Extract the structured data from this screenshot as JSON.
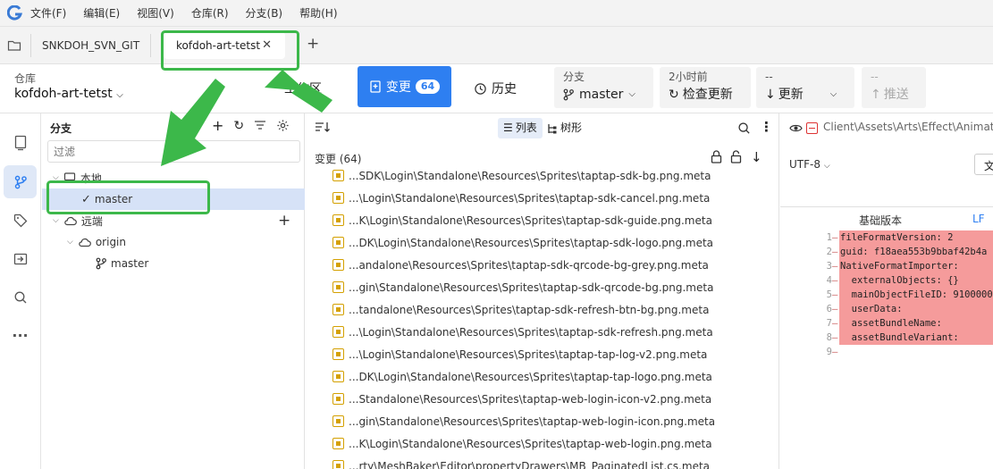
{
  "menu": [
    "文件(F)",
    "编辑(E)",
    "视图(V)",
    "仓库(R)",
    "分支(B)",
    "帮助(H)"
  ],
  "tabs": {
    "tab1": "SNKDOH_SVN_GIT",
    "tab2": "kofdoh-art-tetst"
  },
  "toolbar": {
    "repo_label": "仓库",
    "repo_name": "kofdoh-art-tetst",
    "workarea": "工作区",
    "changes": "变更",
    "changes_count": "64",
    "history": "历史",
    "branch_label": "分支",
    "branch_value": "master",
    "check_label": "2小时前",
    "check_value": "检查更新",
    "update_label": "--",
    "update_value": "更新",
    "push_label": "--",
    "push_value": "推送"
  },
  "branches": {
    "title": "分支",
    "filter_placeholder": "过滤",
    "local": "本地",
    "local_master": "master",
    "remote": "远端",
    "origin": "origin",
    "origin_master": "master"
  },
  "changes": {
    "list_label": "列表",
    "tree_label": "树形",
    "count": "变更 (64)",
    "files": [
      "...SDK\\Login\\Standalone\\Resources\\Sprites\\taptap-sdk-bg.png.meta",
      "...\\Login\\Standalone\\Resources\\Sprites\\taptap-sdk-cancel.png.meta",
      "...K\\Login\\Standalone\\Resources\\Sprites\\taptap-sdk-guide.png.meta",
      "...DK\\Login\\Standalone\\Resources\\Sprites\\taptap-sdk-logo.png.meta",
      "...andalone\\Resources\\Sprites\\taptap-sdk-qrcode-bg-grey.png.meta",
      "...gin\\Standalone\\Resources\\Sprites\\taptap-sdk-qrcode-bg.png.meta",
      "...tandalone\\Resources\\Sprites\\taptap-sdk-refresh-btn-bg.png.meta",
      "...\\Login\\Standalone\\Resources\\Sprites\\taptap-sdk-refresh.png.meta",
      "...\\Login\\Standalone\\Resources\\Sprites\\taptap-tap-log-v2.png.meta",
      "...DK\\Login\\Standalone\\Resources\\Sprites\\taptap-tap-logo.png.meta",
      "...Standalone\\Resources\\Sprites\\taptap-web-login-icon-v2.png.meta",
      "...gin\\Standalone\\Resources\\Sprites\\taptap-web-login-icon.png.meta",
      "...K\\Login\\Standalone\\Resources\\Sprites\\taptap-web-login.png.meta",
      "...rty\\MeshBaker\\Editor\\propertyDrawers\\MB_PaginatedList.cs.meta"
    ]
  },
  "diff": {
    "path": "Client\\Assets\\Arts\\Effect\\Animation",
    "encoding": "UTF-8",
    "baseline": "基础版本",
    "line_ending": "LF",
    "wrap_char": "文",
    "lines": [
      {
        "n": "1",
        "t": "fileFormatVersion: 2"
      },
      {
        "n": "2",
        "t": "guid: f18aea553b9bbaf42b4a"
      },
      {
        "n": "3",
        "t": "NativeFormatImporter:"
      },
      {
        "n": "4",
        "t": "  externalObjects: {}"
      },
      {
        "n": "5",
        "t": "  mainObjectFileID: 9100000"
      },
      {
        "n": "6",
        "t": "  userData:"
      },
      {
        "n": "7",
        "t": "  assetBundleName:"
      },
      {
        "n": "8",
        "t": "  assetBundleVariant:"
      },
      {
        "n": "9",
        "t": ""
      }
    ]
  },
  "colors": {
    "accent": "#2e7ff1",
    "highlight": "#3cb84a",
    "deleted": "#f59b9b"
  }
}
